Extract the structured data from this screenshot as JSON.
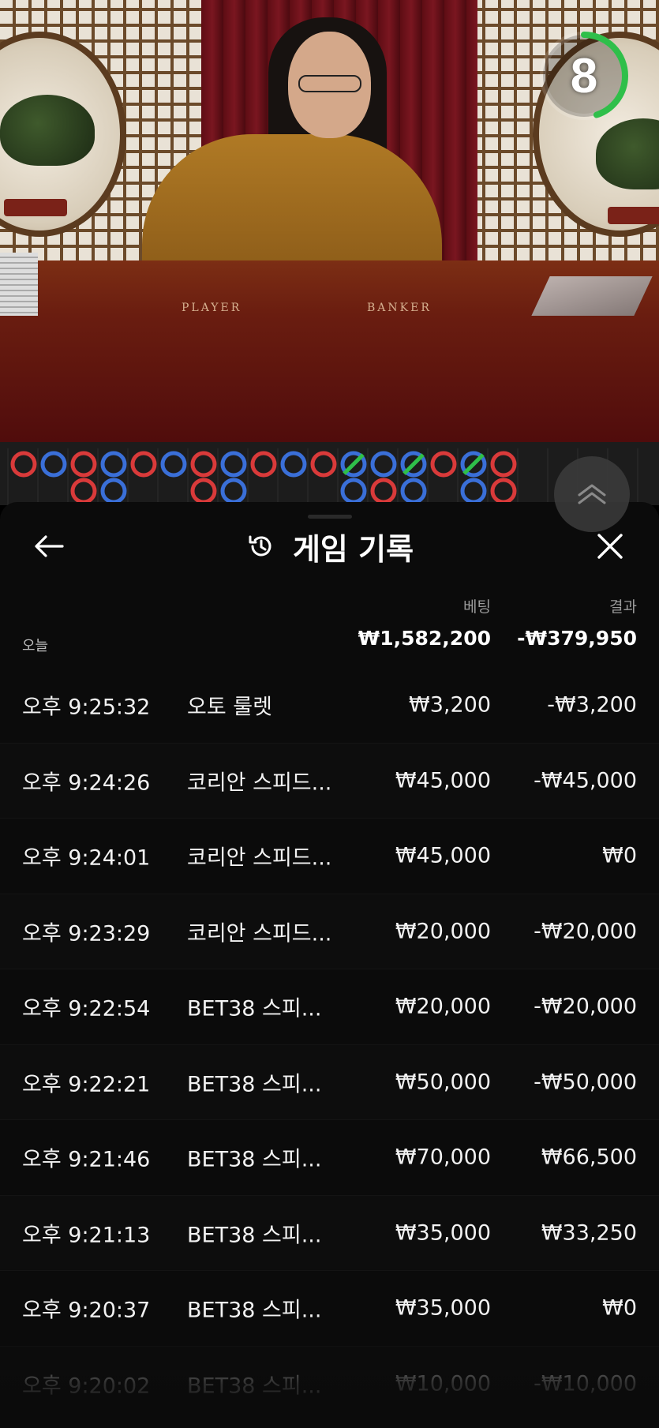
{
  "video": {
    "countdown": "8",
    "countdown_fraction": 0.45,
    "table_labels": {
      "player": "PLAYER",
      "banker": "BANKER"
    },
    "countdown_color": "#2fbf4a"
  },
  "roadmap": {
    "colors": {
      "player": "#3a6fd8",
      "banker": "#d93a3a",
      "tie_slash": "#2fbf4a"
    },
    "top_row": [
      "B",
      "P",
      "B",
      "P",
      "B",
      "P",
      "B",
      "P",
      "B",
      "P",
      "B",
      "P",
      "P",
      "P",
      "B",
      "P",
      "B"
    ],
    "bottom_row": [
      "",
      "",
      "B",
      "P",
      "",
      "",
      "B",
      "P",
      "",
      "",
      "",
      "P",
      "B",
      "P",
      "",
      "P",
      "B"
    ]
  },
  "header": {
    "title": "게임 기록",
    "back_icon": "arrow-left-icon",
    "history_icon": "history-icon",
    "close_icon": "close-icon"
  },
  "summary": {
    "bet_header": "베팅",
    "result_header": "결과",
    "today_label": "오늘",
    "total_bet": "₩1,582,200",
    "total_result": "-₩379,950"
  },
  "rows": [
    {
      "time": "오후 9:25:32",
      "game": "오토 룰렛",
      "bet": "₩3,200",
      "result": "-₩3,200"
    },
    {
      "time": "오후 9:24:26",
      "game": "코리안 스피드...",
      "bet": "₩45,000",
      "result": "-₩45,000"
    },
    {
      "time": "오후 9:24:01",
      "game": "코리안 스피드...",
      "bet": "₩45,000",
      "result": "₩0"
    },
    {
      "time": "오후 9:23:29",
      "game": "코리안 스피드...",
      "bet": "₩20,000",
      "result": "-₩20,000"
    },
    {
      "time": "오후 9:22:54",
      "game": "BET38 스피...",
      "bet": "₩20,000",
      "result": "-₩20,000"
    },
    {
      "time": "오후 9:22:21",
      "game": "BET38 스피...",
      "bet": "₩50,000",
      "result": "-₩50,000"
    },
    {
      "time": "오후 9:21:46",
      "game": "BET38 스피...",
      "bet": "₩70,000",
      "result": "₩66,500"
    },
    {
      "time": "오후 9:21:13",
      "game": "BET38 스피...",
      "bet": "₩35,000",
      "result": "₩33,250"
    },
    {
      "time": "오후 9:20:37",
      "game": "BET38 스피...",
      "bet": "₩35,000",
      "result": "₩0"
    },
    {
      "time": "오후 9:20:02",
      "game": "BET38 스피...",
      "bet": "₩10,000",
      "result": "-₩10,000"
    }
  ]
}
